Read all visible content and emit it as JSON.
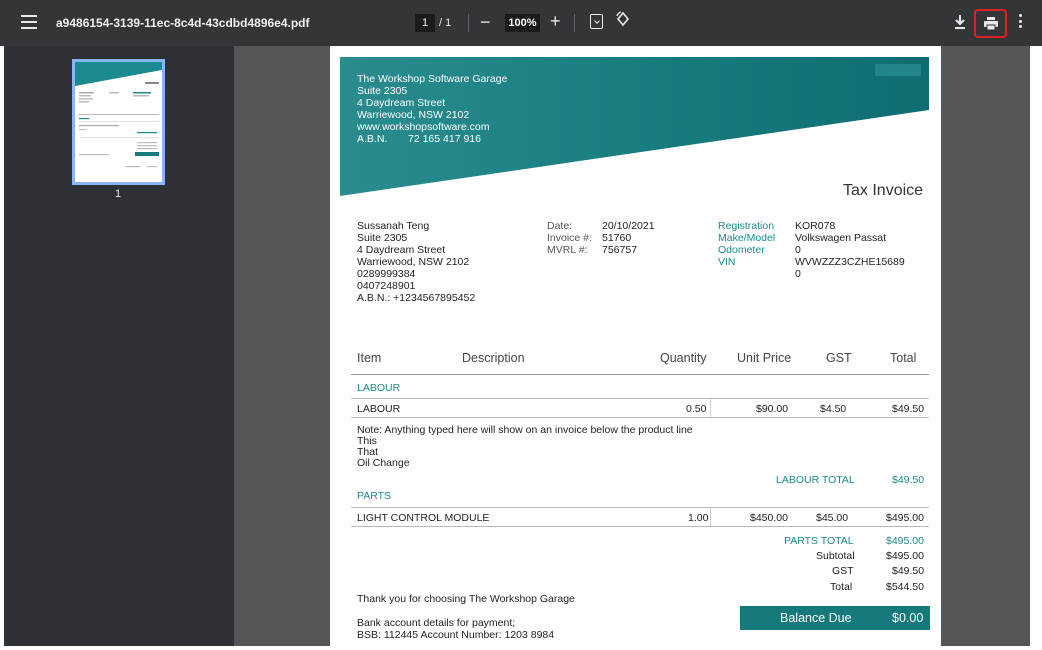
{
  "toolbar": {
    "filename": "a9486154-3139-11ec-8c4d-43cdbd4896e4.pdf",
    "page_current": "1",
    "page_total": "/ 1",
    "zoom": "100%"
  },
  "sidebar": {
    "thumb_label": "1"
  },
  "invoice": {
    "company": {
      "name": "The Workshop Software Garage",
      "line1": "Suite 2305",
      "line2": "4 Daydream Street",
      "line3": "Warriewood, NSW 2102",
      "web": "www.workshopsoftware.com",
      "abn_label": "A.B.N.",
      "abn": "72 165 417 916"
    },
    "title": "Tax Invoice",
    "customer": {
      "name": "Sussanah Teng",
      "line1": "Suite 2305",
      "line2": "4 Daydream Street",
      "line3": "Warriewood, NSW 2102",
      "phone1": "0289999384",
      "phone2": "0407248901",
      "abn": "A.B.N.: +1234567895452"
    },
    "meta": {
      "date_label": "Date:",
      "date": "20/10/2021",
      "inv_label": "Invoice #:",
      "inv": "51760",
      "mvrl_label": "MVRL #:",
      "mvrl": "756757"
    },
    "vehicle": {
      "reg_label": "Registration",
      "reg": "KOR078",
      "make_label": "Make/Model",
      "make": "Volkswagen Passat",
      "odo_label": "Odometer",
      "odo": "0",
      "vin_label": "VIN",
      "vin": "WVWZZZ3CZHE15689",
      "extra": "0"
    },
    "columns": [
      "Item",
      "Description",
      "Quantity",
      "Unit Price",
      "GST",
      "Total"
    ],
    "labour": {
      "section": "LABOUR",
      "row": {
        "item": "LABOUR",
        "qty": "0.50",
        "unit": "$90.00",
        "gst": "$4.50",
        "total": "$49.50"
      },
      "note1": "Note: Anything typed here will show on an invoice below the product line",
      "note2": "This",
      "note3": "That",
      "note4": "Oil Change",
      "total_label": "LABOUR TOTAL",
      "total": "$49.50"
    },
    "parts": {
      "section": "PARTS",
      "row": {
        "item": "LIGHT CONTROL MODULE",
        "qty": "1.00",
        "unit": "$450.00",
        "gst": "$45.00",
        "total": "$495.00"
      },
      "total_label": "PARTS TOTAL",
      "total": "$495.00"
    },
    "totals": {
      "subtotal_label": "Subtotal",
      "subtotal": "$495.00",
      "gst_label": "GST",
      "gst": "$49.50",
      "total_label": "Total",
      "total": "$544.50"
    },
    "thanks": "Thank you for choosing The Workshop Garage",
    "balance_label": "Balance Due",
    "balance": "$0.00",
    "bank1": "Bank account details for payment;",
    "bank2": "BSB: 112445   Account Number: 1203 8984"
  },
  "colors": {
    "accent": "#1a8a8e",
    "toolbar": "#323639",
    "highlight": "#e02020"
  }
}
